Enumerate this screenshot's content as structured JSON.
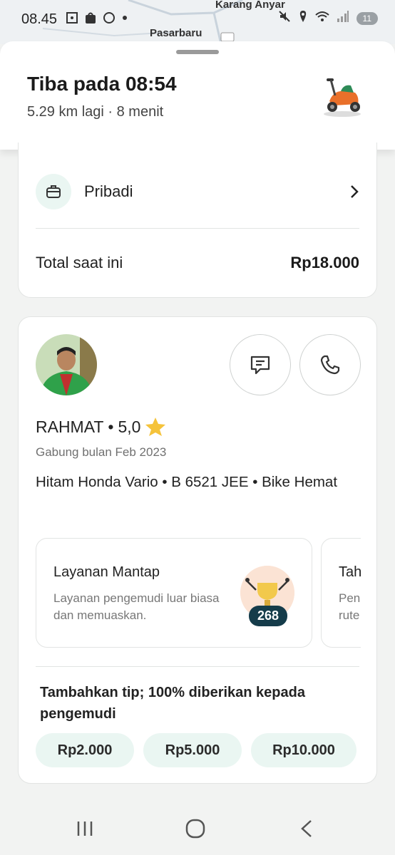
{
  "status_bar": {
    "time": "08.45",
    "battery": "11",
    "map_labels": {
      "top": "Karang Anyar",
      "left": "Pasarbaru"
    }
  },
  "header": {
    "eta_title": "Tiba pada 08:54",
    "eta_subtitle": "5.29 km lagi · 8 menit"
  },
  "payment": {
    "profile_label": "Pribadi",
    "total_label": "Total saat ini",
    "total_value": "Rp18.000"
  },
  "driver": {
    "name": "RAHMAT",
    "bullet": "•",
    "rating": "5,0",
    "joined": "Gabung bulan Feb 2023",
    "vehicle": "Hitam Honda Vario • B 6521 JEE • Bike Hemat"
  },
  "badges": [
    {
      "title": "Layanan Mantap",
      "description": "Layanan pengemudi luar biasa dan memuaskan.",
      "count": "268"
    },
    {
      "title": "Tah",
      "description": "Pen rute"
    }
  ],
  "tip": {
    "title": "Tambahkan tip; 100% diberikan kepada pengemudi",
    "options": [
      "Rp2.000",
      "Rp5.000",
      "Rp10.000"
    ]
  },
  "colors": {
    "accent_light": "#eaf6f2",
    "badge_count_bg": "#153c4a",
    "star": "#f5c33b"
  }
}
